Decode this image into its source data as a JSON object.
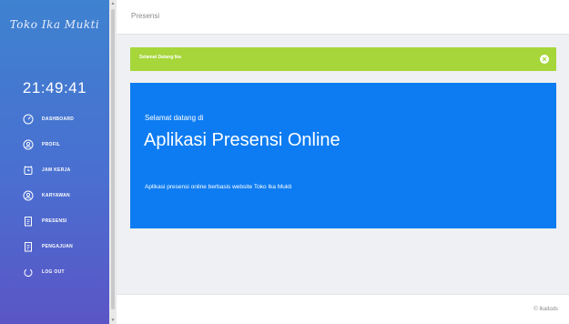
{
  "sidebar": {
    "brand": "Toko Ika Mukti",
    "clock": "21:49:41",
    "items": [
      {
        "label": "DASHBOARD",
        "icon": "dashboard-icon"
      },
      {
        "label": "PROFIL",
        "icon": "profile-icon"
      },
      {
        "label": "JAM KERJA",
        "icon": "clock-icon"
      },
      {
        "label": "KARYAWAN",
        "icon": "employee-icon"
      },
      {
        "label": "PRESENSI",
        "icon": "clipboard-icon"
      },
      {
        "label": "PENGAJUAN",
        "icon": "document-icon"
      },
      {
        "label": "LOG OUT",
        "icon": "power-icon"
      }
    ]
  },
  "header": {
    "title": "Presensi"
  },
  "alert": {
    "text": "Selamat Datang Ika"
  },
  "hero": {
    "subtitle": "Selamat datang di",
    "title": "Aplikasi Presensi Online",
    "description": "Aplikasi presensi online berbasis website Toko Ika Mukti"
  },
  "footer": {
    "text": "© Ikaitods"
  },
  "colors": {
    "accent": "#0d7cf2",
    "alert": "#a6d63a",
    "sidebar_top": "#3e82d0",
    "sidebar_bottom": "#5b55c6"
  }
}
